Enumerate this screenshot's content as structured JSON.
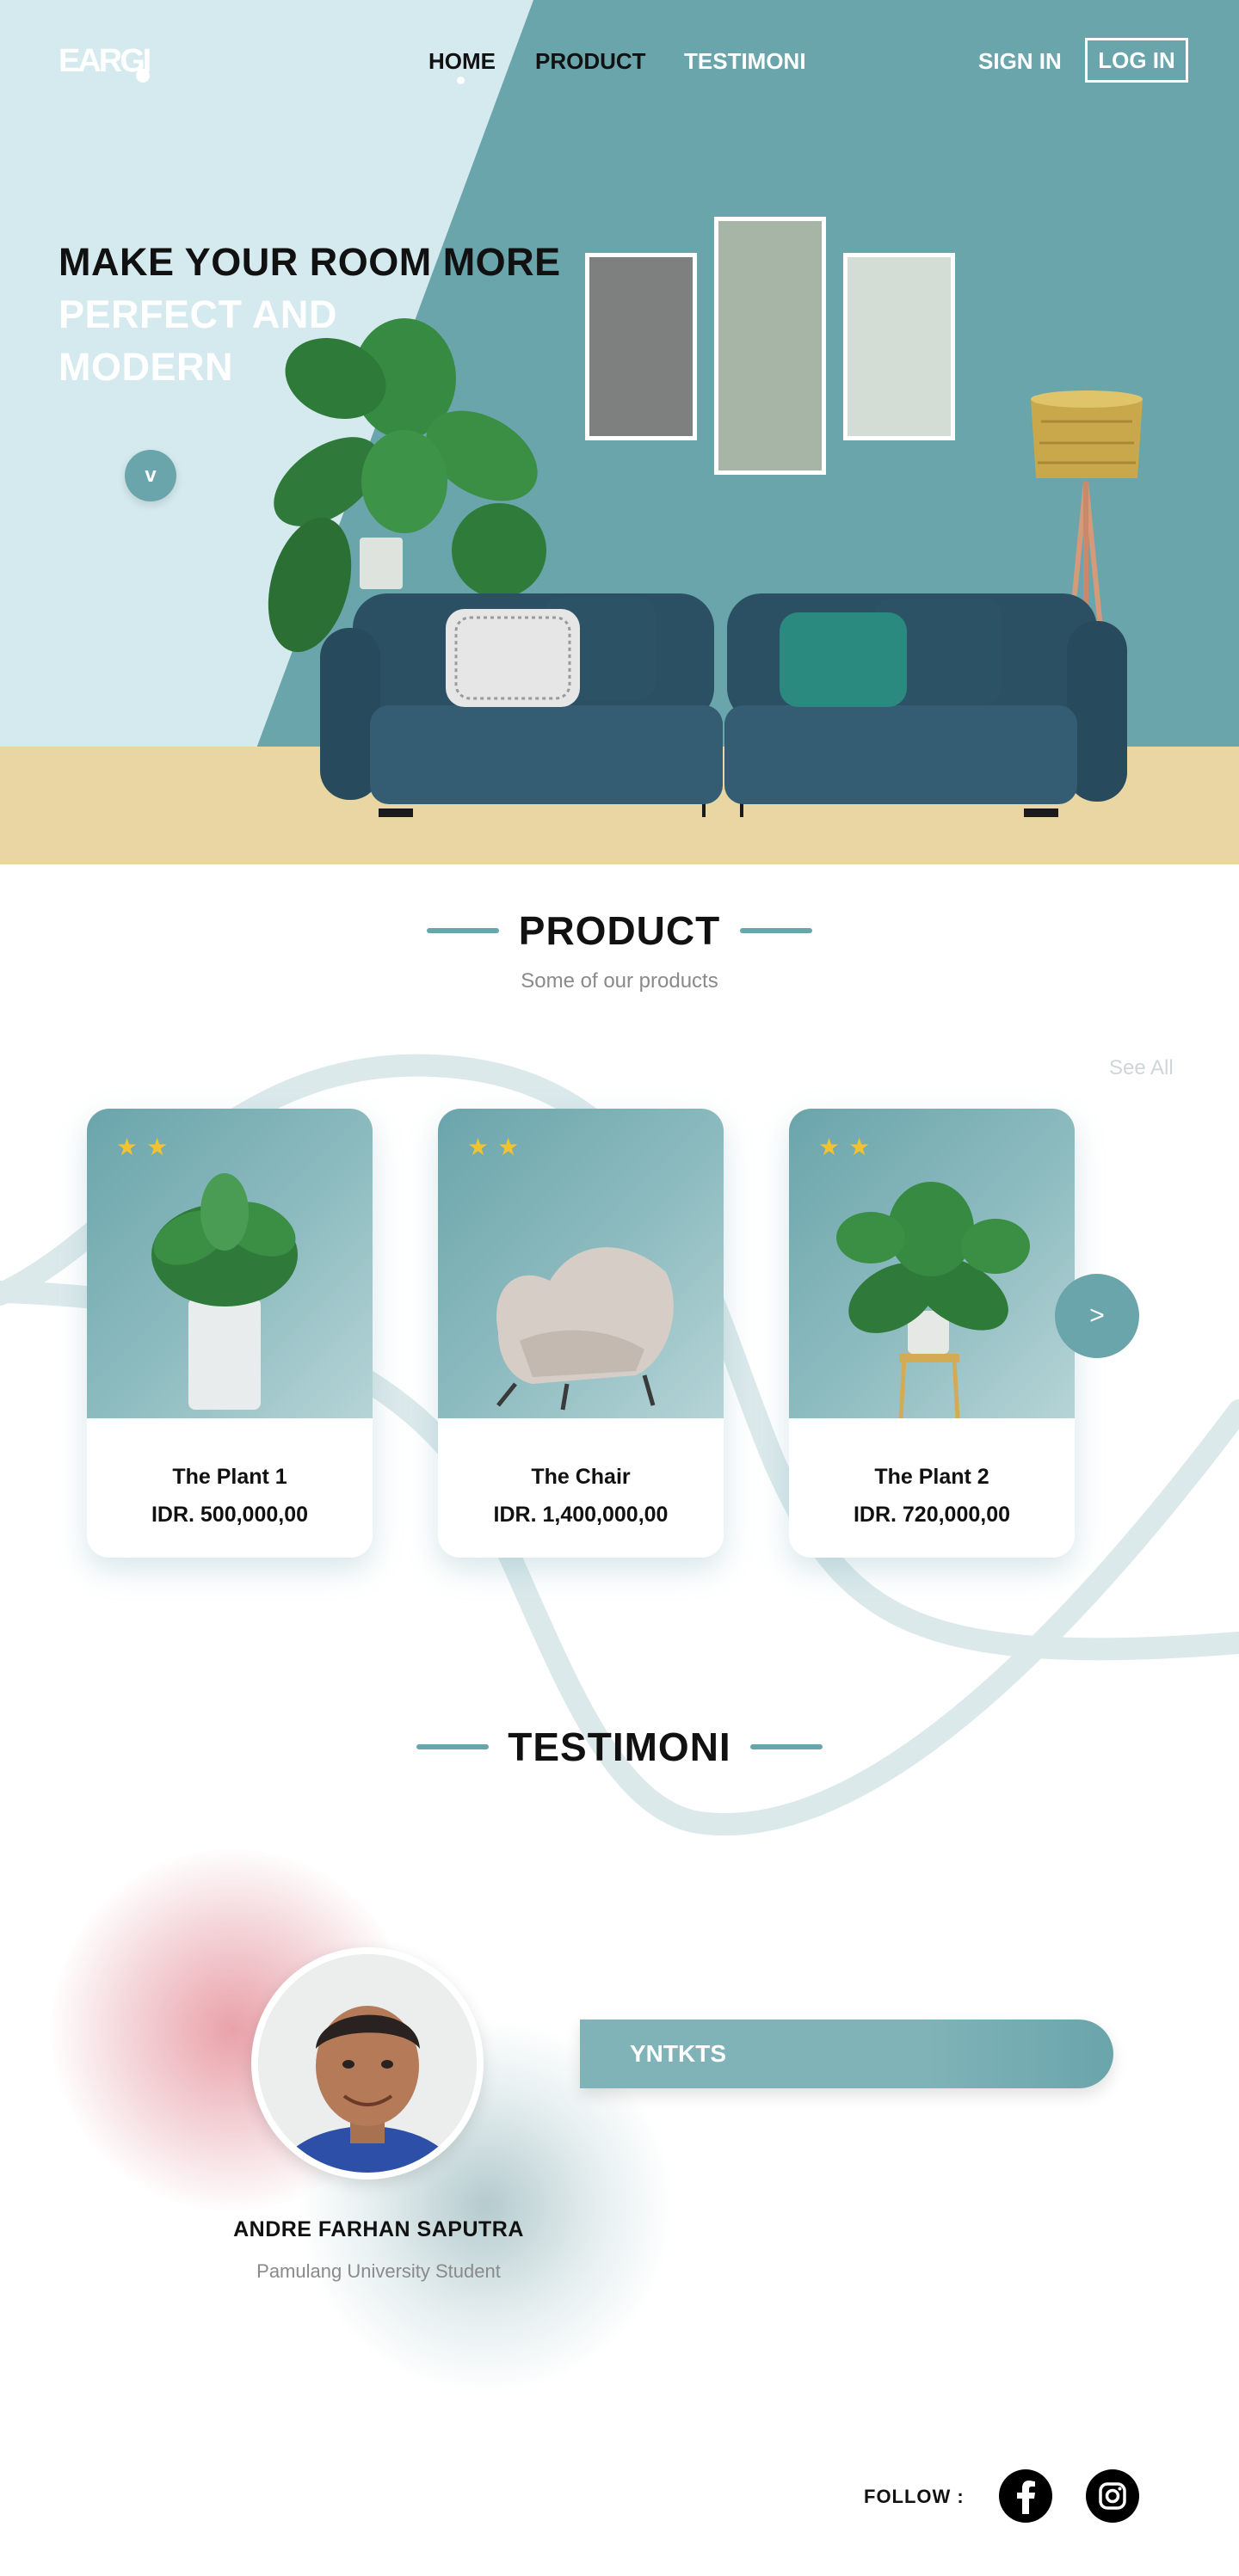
{
  "brand": {
    "logo_text": "EARGI"
  },
  "nav": {
    "home": "HOME",
    "product": "PRODUCT",
    "testimoni": "TESTIMONI",
    "sign_in": "SIGN IN",
    "log_in": "LOG IN"
  },
  "hero": {
    "line1": "MAKE YOUR ROOM MORE",
    "line2": "PERFECT AND",
    "line3": "MODERN",
    "scroll_label": "v"
  },
  "product_section": {
    "title": "PRODUCT",
    "subtitle": "Some of our products",
    "see_all": "See All",
    "next_label": ">",
    "items": [
      {
        "name": "The Plant 1",
        "price": "IDR. 500,000,00",
        "stars": "★★"
      },
      {
        "name": "The Chair",
        "price": "IDR. 1,400,000,00",
        "stars": "★★"
      },
      {
        "name": "The Plant 2",
        "price": "IDR. 720,000,00",
        "stars": "★★"
      }
    ]
  },
  "testimoni_section": {
    "title": "TESTIMONI",
    "name": "ANDRE FARHAN SAPUTRA",
    "role": "Pamulang University Student",
    "quote": "YNTKTS"
  },
  "footer": {
    "follow": "FOLLOW  :"
  },
  "colors": {
    "accent": "#6aa5ab",
    "hero_light": "#d4eaee",
    "floor": "#e9d6a2",
    "star": "#f2c230"
  }
}
